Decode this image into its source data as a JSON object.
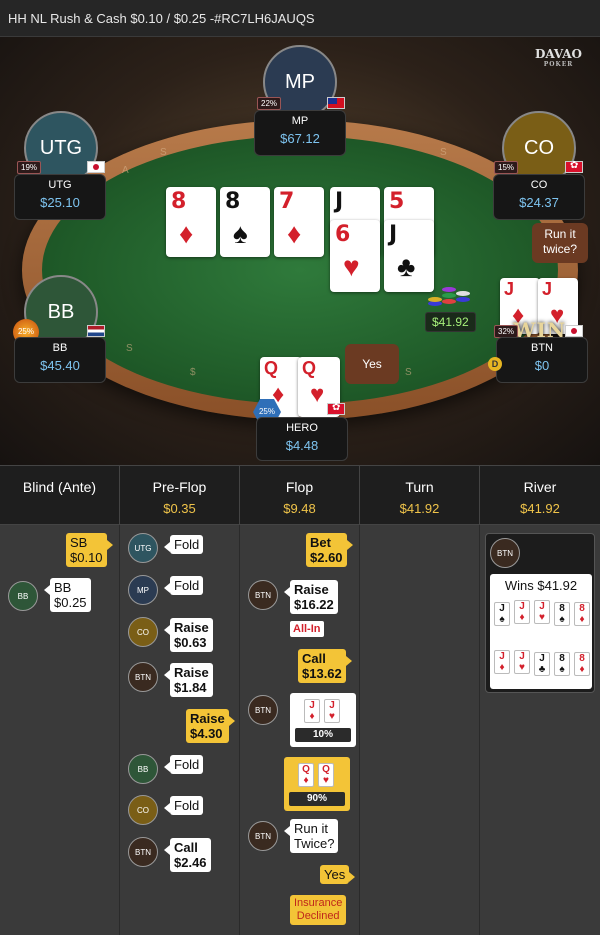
{
  "header": {
    "title": "HH NL Rush & Cash $0.10 / $0.25 -#RC7LH6JAUQS"
  },
  "logo": {
    "text": "DAVAO",
    "sub": "POKER"
  },
  "seats": {
    "mp": {
      "label": "MP",
      "name": "MP",
      "stack": "$67.12",
      "stat": "22%"
    },
    "utg": {
      "label": "UTG",
      "name": "UTG",
      "stack": "$25.10",
      "stat": "19%"
    },
    "co": {
      "label": "CO",
      "name": "CO",
      "stack": "$24.37",
      "stat": "15%"
    },
    "bb": {
      "label": "BB",
      "name": "BB",
      "stack": "$45.40",
      "stat": "25%"
    },
    "hero": {
      "name": "HERO",
      "stack": "$4.48",
      "stat": "25%"
    },
    "btn": {
      "name": "BTN",
      "stack": "$0",
      "stat": "32%"
    }
  },
  "board": {
    "run1": [
      {
        "rank": "8",
        "suit": "♦",
        "color": "#d3202b"
      },
      {
        "rank": "8",
        "suit": "♠",
        "color": "#111111"
      },
      {
        "rank": "7",
        "suit": "♦",
        "color": "#d3202b"
      },
      {
        "rank": "J",
        "suit": "♠",
        "color": "#111111"
      },
      {
        "rank": "5",
        "suit": "♥",
        "color": "#d3202b"
      }
    ],
    "run2": [
      {
        "rank": "6",
        "suit": "♥",
        "color": "#d3202b"
      },
      {
        "rank": "J",
        "suit": "♣",
        "color": "#111111"
      }
    ]
  },
  "pot": "$41.92",
  "bubbles": {
    "run_it_twice": "Run it twice?",
    "yes": "Yes"
  },
  "win_banner": "WIN",
  "dealer_button": "D",
  "hero_cards": [
    {
      "rank": "Q",
      "suit": "♦"
    },
    {
      "rank": "Q",
      "suit": "♥"
    }
  ],
  "btn_cards": [
    {
      "rank": "J",
      "suit": "♦"
    },
    {
      "rank": "J",
      "suit": "♥"
    }
  ],
  "streets": [
    {
      "name": "Blind (Ante)",
      "pot": ""
    },
    {
      "name": "Pre-Flop",
      "pot": "$0.35"
    },
    {
      "name": "Flop",
      "pot": "$9.48"
    },
    {
      "name": "Turn",
      "pot": "$41.92"
    },
    {
      "name": "River",
      "pot": "$41.92"
    }
  ],
  "log": {
    "blind": {
      "sb": "SB\n$0.10",
      "bb_pos": "BB",
      "bb": "BB\n$0.25"
    },
    "preflop": [
      {
        "pos": "UTG",
        "action": "Fold"
      },
      {
        "pos": "MP",
        "action": "Fold"
      },
      {
        "pos": "CO",
        "action": "Raise\n$0.63"
      },
      {
        "pos": "BTN",
        "action": "Raise\n$1.84"
      },
      {
        "pos": "",
        "action": "Raise\n$4.30"
      },
      {
        "pos": "BB",
        "action": "Fold"
      },
      {
        "pos": "CO",
        "action": "Fold"
      },
      {
        "pos": "BTN",
        "action": "Call\n$2.46"
      }
    ],
    "flop": {
      "bet": "Bet\n$2.60",
      "raise": "Raise\n$16.22",
      "allin": "All-In",
      "call": "Call\n$13.62",
      "btn_equity": "10%",
      "hero_equity": "90%",
      "run_it_twice": "Run it\nTwice?",
      "yes": "Yes",
      "insurance": "Insurance\nDeclined",
      "btn_label": "BTN"
    },
    "river": {
      "pos": "BTN",
      "wins": "Wins $41.92"
    }
  }
}
